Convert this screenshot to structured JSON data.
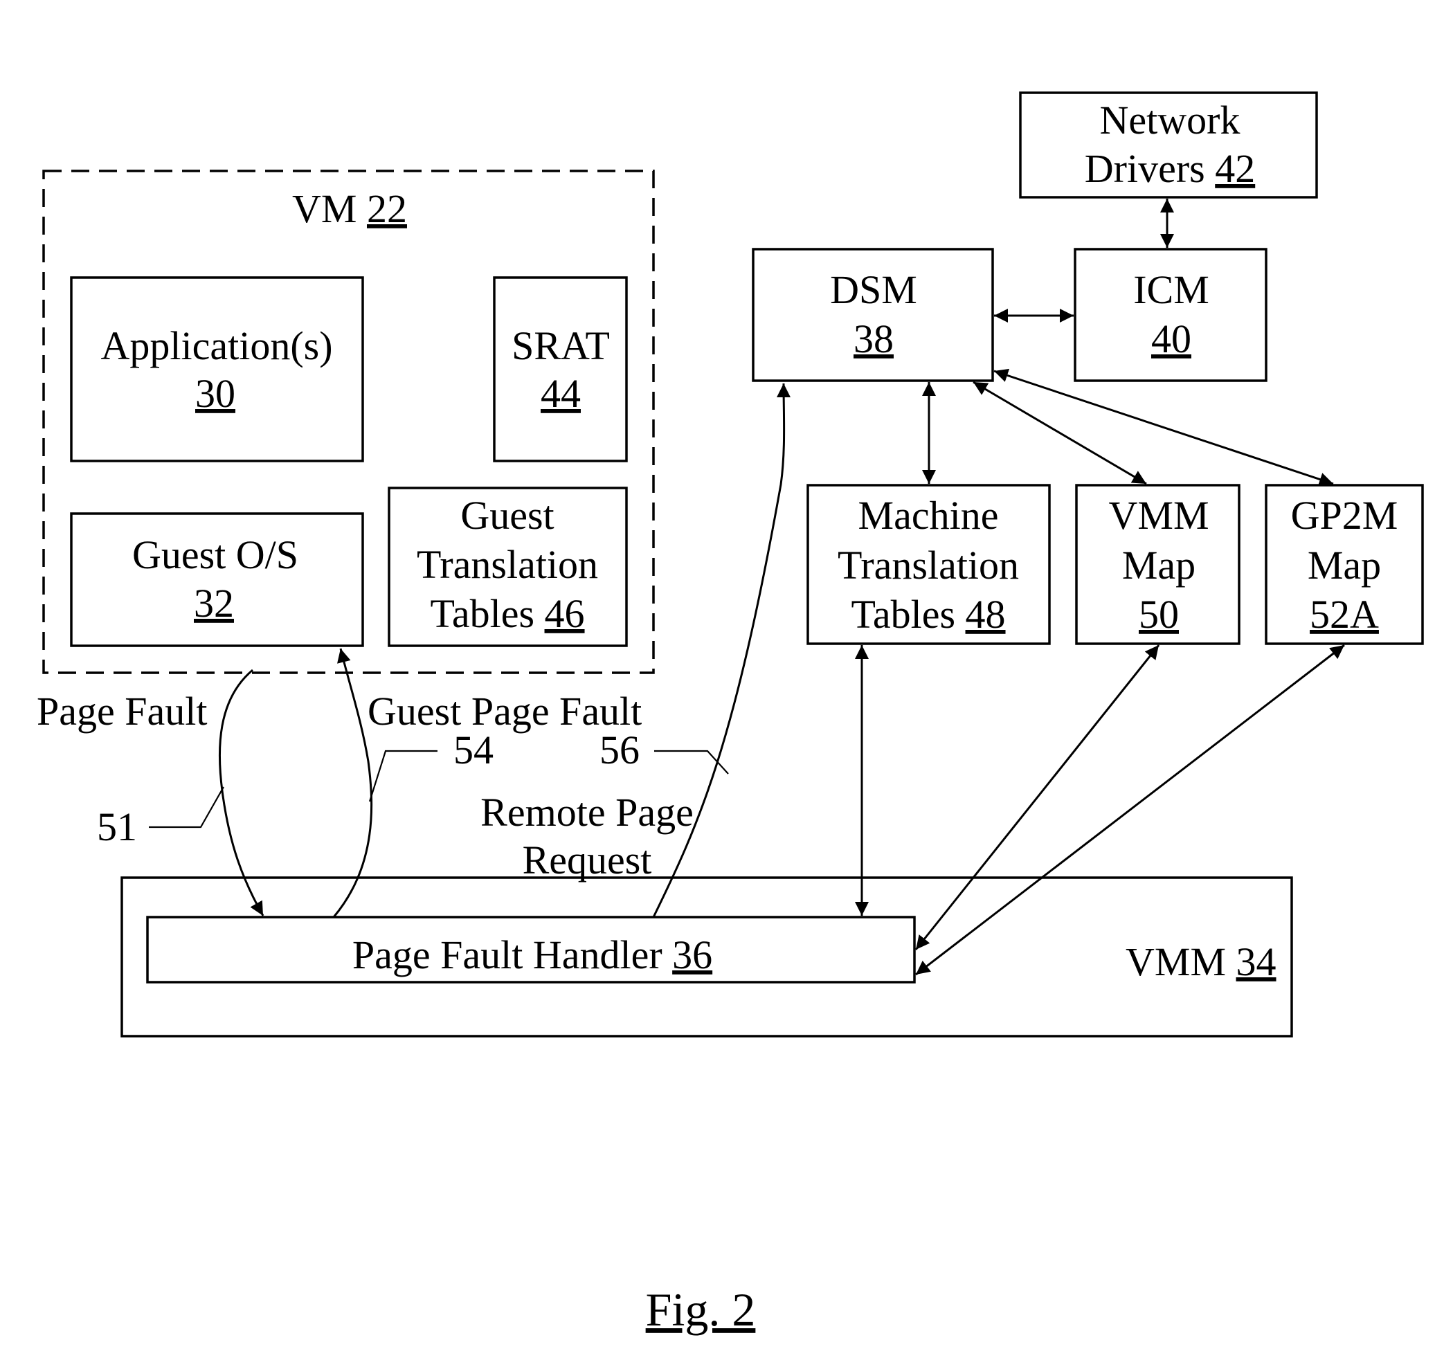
{
  "figure": {
    "caption": "Fig. 2",
    "vm": {
      "label": "VM ",
      "ref": "22"
    },
    "applications": {
      "line1": "Application(s)",
      "ref": "30"
    },
    "srat": {
      "line1": "SRAT",
      "ref": "44"
    },
    "guest_os": {
      "line1": "Guest O/S",
      "ref": "32"
    },
    "guest_tt": {
      "line1": "Guest",
      "line2": "Translation",
      "line3": "Tables ",
      "ref": "46"
    },
    "network_drivers": {
      "line1": "Network",
      "line2": "Drivers ",
      "ref": "42"
    },
    "dsm": {
      "line1": "DSM",
      "ref": "38"
    },
    "icm": {
      "line1": "ICM",
      "ref": "40"
    },
    "machine_tt": {
      "line1": "Machine",
      "line2": "Translation",
      "line3": "Tables ",
      "ref": "48"
    },
    "vmm_map": {
      "line1": "VMM",
      "line2": "Map",
      "ref": "50"
    },
    "gp2m_map": {
      "line1": "GP2M",
      "line2": "Map",
      "ref": "52A"
    },
    "vmm": {
      "label": "VMM ",
      "ref": "34"
    },
    "page_fault_handler": {
      "label": "Page Fault Handler ",
      "ref": "36"
    },
    "flows": {
      "page_fault": {
        "label": "Page Fault",
        "ref": "51"
      },
      "guest_page_fault": {
        "label": "Guest Page Fault",
        "ref": "54"
      },
      "remote_page_request": {
        "line1": "Remote Page",
        "line2": "Request",
        "ref": "56"
      }
    }
  }
}
